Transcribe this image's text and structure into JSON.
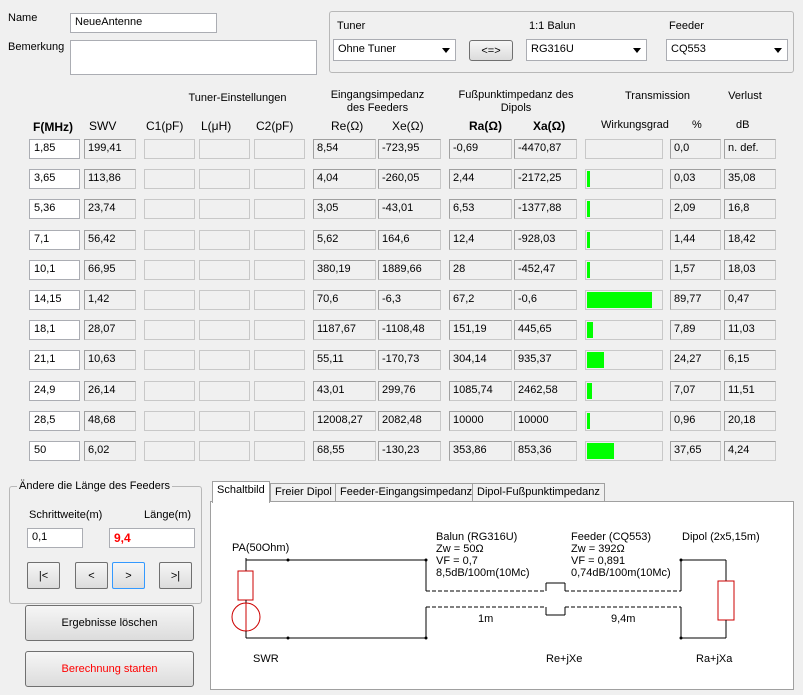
{
  "form": {
    "name_label": "Name",
    "name_value": "NeueAntenne",
    "remark_label": "Bemerkung",
    "remark_value": ""
  },
  "selectors": {
    "tuner_label": "Tuner",
    "tuner_value": "Ohne Tuner",
    "swap_label": "<=>",
    "balun_label": "1:1 Balun",
    "balun_value": "RG316U",
    "feeder_label": "Feeder",
    "feeder_value": "CQ553"
  },
  "headers": {
    "tuner_settings": "Tuner-Einstellungen",
    "feed_impedance": "Eingangsimpedanz des Feeders",
    "dipole_impedance": "Fußpunktimpedanz des Dipols",
    "transmission": "Transmission",
    "loss": "Verlust",
    "f": "F(MHz)",
    "swr": "SWV",
    "c1": "C1(pF)",
    "l": "L(μH)",
    "c2": "C2(pF)",
    "re": "Re(Ω)",
    "xe": "Xe(Ω)",
    "ra": "Ra(Ω)",
    "xa": "Xa(Ω)",
    "efficiency": "Wirkungsgrad",
    "percent": "%",
    "db": "dB"
  },
  "rows": [
    {
      "f": "1,85",
      "swr": "199,41",
      "re": "8,54",
      "xe": "-723,95",
      "ra": "-0,69",
      "xa": "-4470,87",
      "pct": "0,0",
      "eff": 0.0,
      "db": "n. def."
    },
    {
      "f": "3,65",
      "swr": "113,86",
      "re": "4,04",
      "xe": "-260,05",
      "ra": "2,44",
      "xa": "-2172,25",
      "pct": "0,03",
      "eff": 0.03,
      "db": "35,08"
    },
    {
      "f": "5,36",
      "swr": "23,74",
      "re": "3,05",
      "xe": "-43,01",
      "ra": "6,53",
      "xa": "-1377,88",
      "pct": "2,09",
      "eff": 2.09,
      "db": "16,8"
    },
    {
      "f": "7,1",
      "swr": "56,42",
      "re": "5,62",
      "xe": "164,6",
      "ra": "12,4",
      "xa": "-928,03",
      "pct": "1,44",
      "eff": 1.44,
      "db": "18,42"
    },
    {
      "f": "10,1",
      "swr": "66,95",
      "re": "380,19",
      "xe": "1889,66",
      "ra": "28",
      "xa": "-452,47",
      "pct": "1,57",
      "eff": 1.57,
      "db": "18,03"
    },
    {
      "f": "14,15",
      "swr": "1,42",
      "re": "70,6",
      "xe": "-6,3",
      "ra": "67,2",
      "xa": "-0,6",
      "pct": "89,77",
      "eff": 89.77,
      "db": "0,47"
    },
    {
      "f": "18,1",
      "swr": "28,07",
      "re": "1187,67",
      "xe": "-1108,48",
      "ra": "151,19",
      "xa": "445,65",
      "pct": "7,89",
      "eff": 7.89,
      "db": "11,03"
    },
    {
      "f": "21,1",
      "swr": "10,63",
      "re": "55,11",
      "xe": "-170,73",
      "ra": "304,14",
      "xa": "935,37",
      "pct": "24,27",
      "eff": 24.27,
      "db": "6,15"
    },
    {
      "f": "24,9",
      "swr": "26,14",
      "re": "43,01",
      "xe": "299,76",
      "ra": "1085,74",
      "xa": "2462,58",
      "pct": "7,07",
      "eff": 7.07,
      "db": "11,51"
    },
    {
      "f": "28,5",
      "swr": "48,68",
      "re": "12008,27",
      "xe": "2082,48",
      "ra": "10000",
      "xa": "10000",
      "pct": "0,96",
      "eff": 0.96,
      "db": "20,18"
    },
    {
      "f": "50",
      "swr": "6,02",
      "re": "68,55",
      "xe": "-130,23",
      "ra": "353,86",
      "xa": "853,36",
      "pct": "37,65",
      "eff": 37.65,
      "db": "4,24"
    }
  ],
  "feeder_group": {
    "title": "Ändere die Länge des Feeders",
    "step_label": "Schrittweite(m)",
    "length_label": "Länge(m)",
    "step_value": "0,1",
    "length_value": "9,4",
    "first_btn": "|<",
    "prev_btn": "<",
    "next_btn": ">",
    "last_btn": ">|"
  },
  "actions": {
    "clear_label": "Ergebnisse löschen",
    "start_label": "Berechnung starten"
  },
  "tabs": [
    "Schaltbild",
    "Freier Dipol",
    "Feeder-Eingangsimpedanz",
    "Dipol-Fußpunktimpedanz"
  ],
  "schematic": {
    "pa_label": "PA(50Ohm)",
    "balun_title": "Balun (RG316U)",
    "balun_zw": "Zw = 50Ω",
    "balun_vf": "VF = 0,7",
    "balun_att": "8,5dB/100m(10Mc)",
    "feeder_title": "Feeder (CQ553)",
    "feeder_zw": "Zw = 392Ω",
    "feeder_vf": "VF = 0,891",
    "feeder_att": "0,74dB/100m(10Mc)",
    "dipole_title": "Dipol (2x5,15m)",
    "balun_len": "1m",
    "feeder_len": "9,4m",
    "swr": "SWR",
    "re_xe": "Re+jXe",
    "ra_xa": "Ra+jXa"
  },
  "colors": {
    "bar": "#00ff00",
    "accent_red": "#ff0000"
  }
}
